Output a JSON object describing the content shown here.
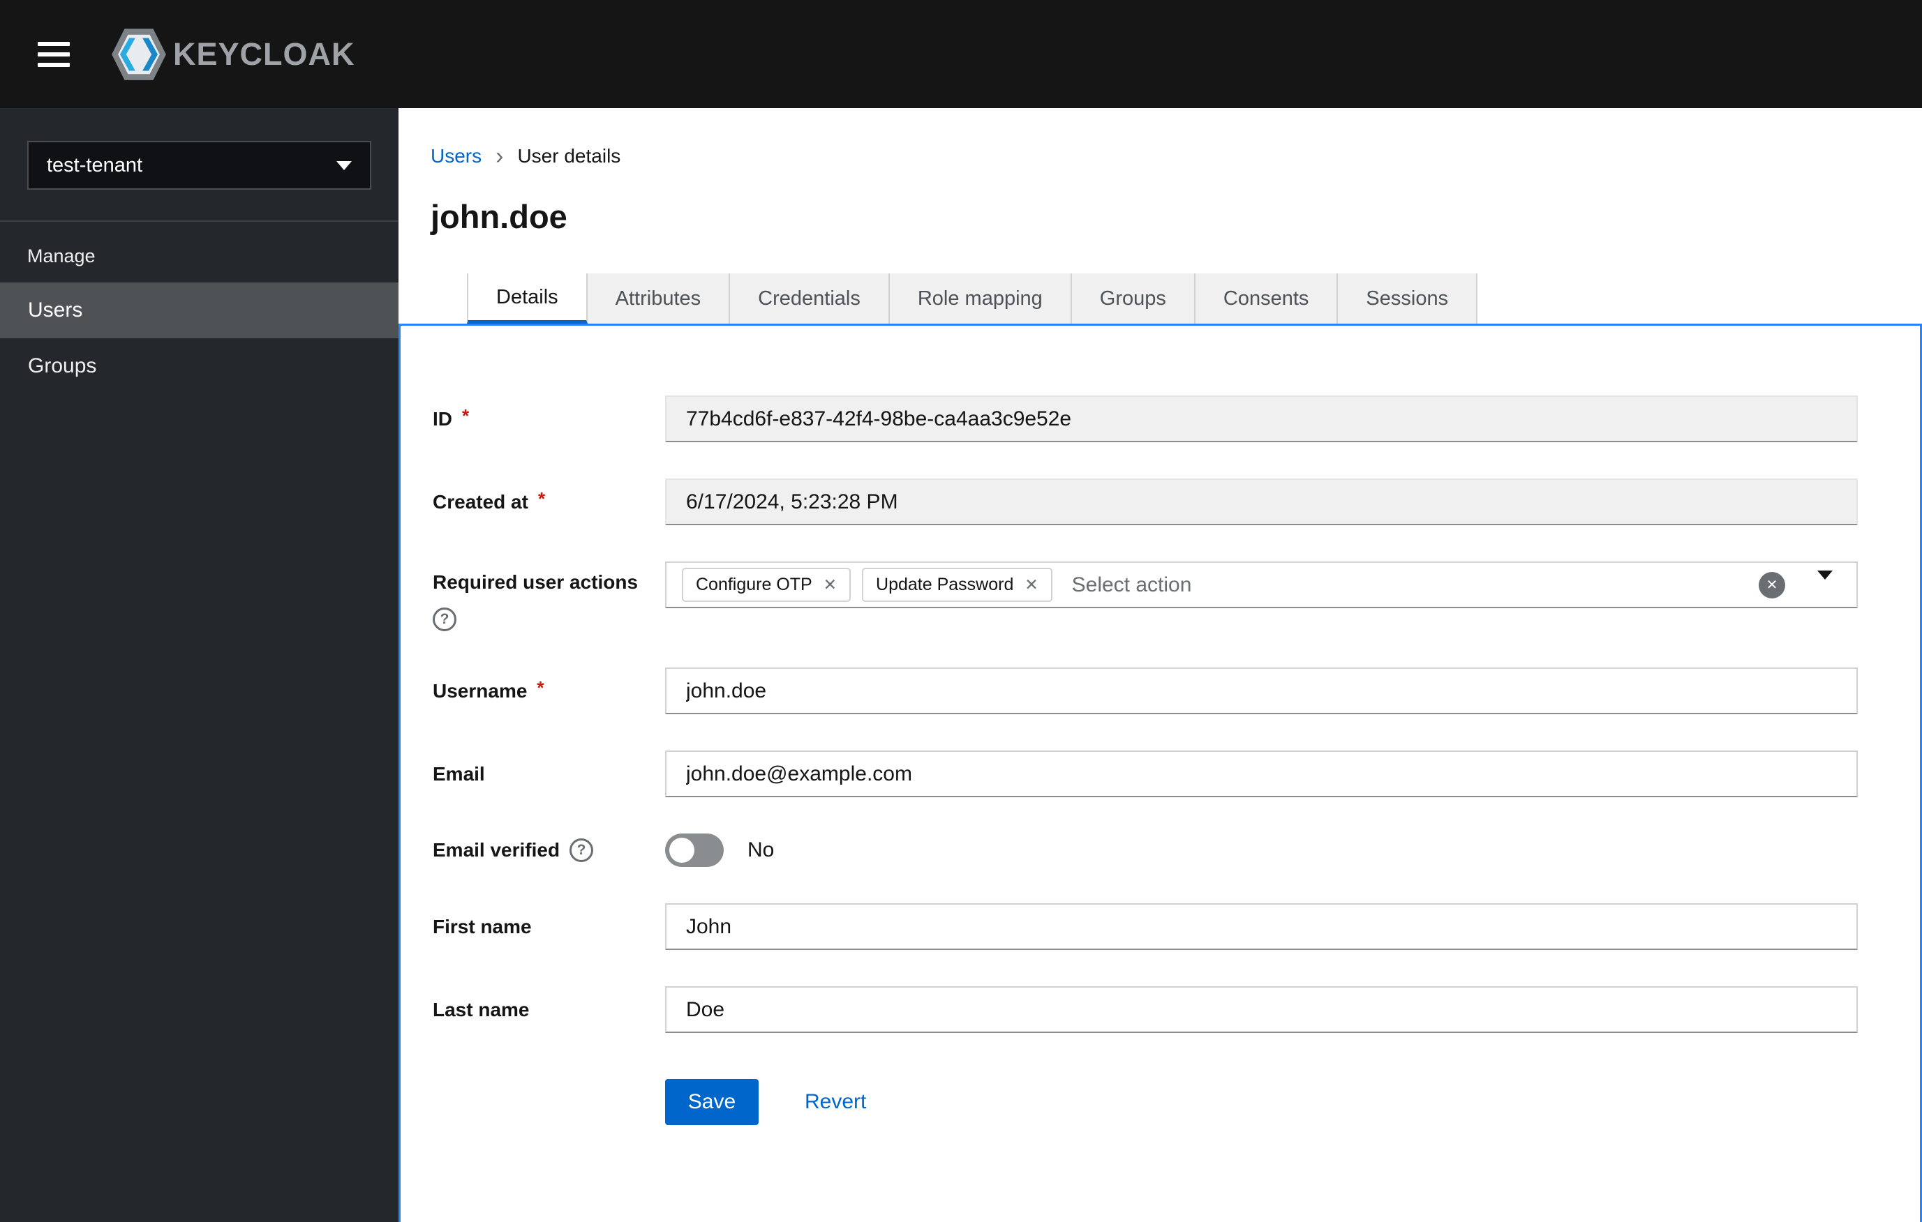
{
  "header": {
    "brand": "KEYCLOAK"
  },
  "sidebar": {
    "realm": "test-tenant",
    "section_label": "Manage",
    "items": [
      {
        "label": "Users",
        "active": true
      },
      {
        "label": "Groups",
        "active": false
      }
    ]
  },
  "breadcrumb": {
    "link": "Users",
    "separator": "›",
    "current": "User details"
  },
  "page": {
    "title": "john.doe"
  },
  "tabs": [
    "Details",
    "Attributes",
    "Credentials",
    "Role mapping",
    "Groups",
    "Consents",
    "Sessions"
  ],
  "active_tab": "Details",
  "form": {
    "required_indicator": "*",
    "fields": {
      "id": {
        "label": "ID",
        "required": true,
        "readonly": true,
        "value": "77b4cd6f-e837-42f4-98be-ca4aa3c9e52e"
      },
      "created_at": {
        "label": "Created at",
        "required": true,
        "readonly": true,
        "value": "6/17/2024, 5:23:28 PM"
      },
      "required_user_actions": {
        "label": "Required user actions",
        "chips": [
          "Configure OTP",
          "Update Password"
        ],
        "placeholder": "Select action"
      },
      "username": {
        "label": "Username",
        "required": true,
        "value": "john.doe"
      },
      "email": {
        "label": "Email",
        "value": "john.doe@example.com"
      },
      "email_verified": {
        "label": "Email verified",
        "enabled": false,
        "state": "No"
      },
      "first_name": {
        "label": "First name",
        "value": "John"
      },
      "last_name": {
        "label": "Last name",
        "value": "Doe"
      }
    },
    "actions": {
      "save": "Save",
      "revert": "Revert"
    }
  },
  "icons": {
    "close": "✕",
    "question": "?"
  },
  "colors": {
    "accent": "#0066cc",
    "masthead_bg": "#151515",
    "sidebar_bg": "#24272b",
    "nav_selected_bg": "#4f5255",
    "panel_focus_border": "#2684ff",
    "required": "#c9190b",
    "readonly_bg": "#f0f0f0"
  }
}
